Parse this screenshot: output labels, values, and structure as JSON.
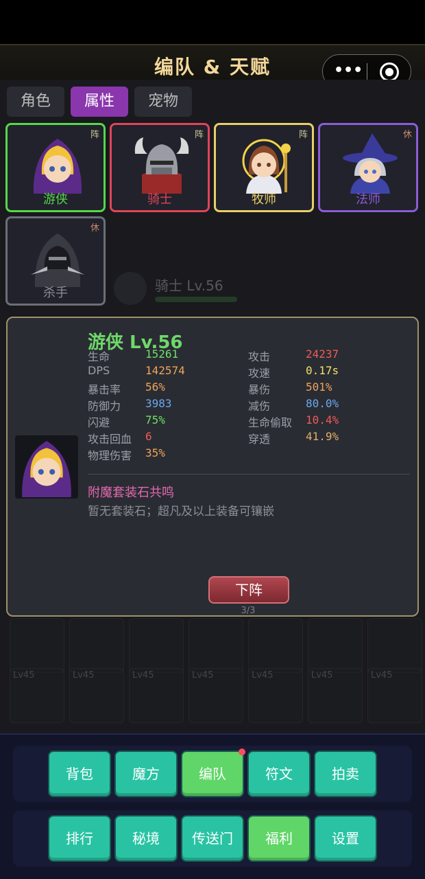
{
  "header": {
    "title": "编队 & 天赋"
  },
  "capsule": {
    "more_glyph": "•••"
  },
  "tabs": [
    {
      "label": "角色",
      "active": false
    },
    {
      "label": "属性",
      "active": true
    },
    {
      "label": "宠物",
      "active": false
    }
  ],
  "roster": [
    {
      "name": "游侠",
      "flag": "阵",
      "color": "#55d84a"
    },
    {
      "name": "骑士",
      "flag": "阵",
      "color": "#e0445a"
    },
    {
      "name": "牧师",
      "flag": "阵",
      "color": "#e8cf6a"
    },
    {
      "name": "法师",
      "flag": "休",
      "color": "#8b5cd6"
    },
    {
      "name": "杀手",
      "flag": "休",
      "color": "#6c6e78"
    }
  ],
  "ghost": {
    "text": "骑士 Lv.56"
  },
  "detail": {
    "title": "游侠 Lv.56",
    "stats_left": [
      {
        "label": "生命",
        "value": "15261",
        "color": "#6fe06a"
      },
      {
        "label": "DPS",
        "value": "142574",
        "color": "#f0a45a"
      },
      {
        "label": "暴击率",
        "value": "56%",
        "color": "#f0a45a"
      },
      {
        "label": "防御力",
        "value": "3983",
        "color": "#6aa8f0"
      },
      {
        "label": "闪避",
        "value": "75%",
        "color": "#6fe06a"
      },
      {
        "label": "攻击回血",
        "value": "6",
        "color": "#ef5a5a"
      },
      {
        "label": "物理伤害",
        "value": "35%",
        "color": "#f0a45a"
      }
    ],
    "stats_right": [
      {
        "label": "攻击",
        "value": "24237",
        "color": "#ef5a5a"
      },
      {
        "label": "攻速",
        "value": "0.17s",
        "color": "#f0e06a"
      },
      {
        "label": "暴伤",
        "value": "501%",
        "color": "#f0a45a"
      },
      {
        "label": "减伤",
        "value": "80.0%",
        "color": "#6aa8f0"
      },
      {
        "label": "生命偷取",
        "value": "10.4%",
        "color": "#ef5a5a"
      },
      {
        "label": "穿透",
        "value": "41.9%",
        "color": "#e0b06a"
      }
    ],
    "set_title": "附魔套装石共鸣",
    "set_desc": "暂无套装石；超凡及以上装备可镶嵌",
    "remove_label": "下阵",
    "pager": "3/3"
  },
  "inventory": {
    "level_tags": [
      "Lv45",
      "Lv45",
      "Lv45",
      "Lv45",
      "Lv45",
      "Lv45",
      "Lv45"
    ]
  },
  "nav_row1": [
    {
      "label": "背包",
      "style": "teal"
    },
    {
      "label": "魔方",
      "style": "teal"
    },
    {
      "label": "编队",
      "style": "lime",
      "badge": true
    },
    {
      "label": "符文",
      "style": "teal"
    },
    {
      "label": "拍卖",
      "style": "teal"
    }
  ],
  "nav_row2": [
    {
      "label": "排行",
      "style": "teal"
    },
    {
      "label": "秘境",
      "style": "teal"
    },
    {
      "label": "传送门",
      "style": "teal"
    },
    {
      "label": "福利",
      "style": "lime"
    },
    {
      "label": "设置",
      "style": "teal"
    }
  ]
}
